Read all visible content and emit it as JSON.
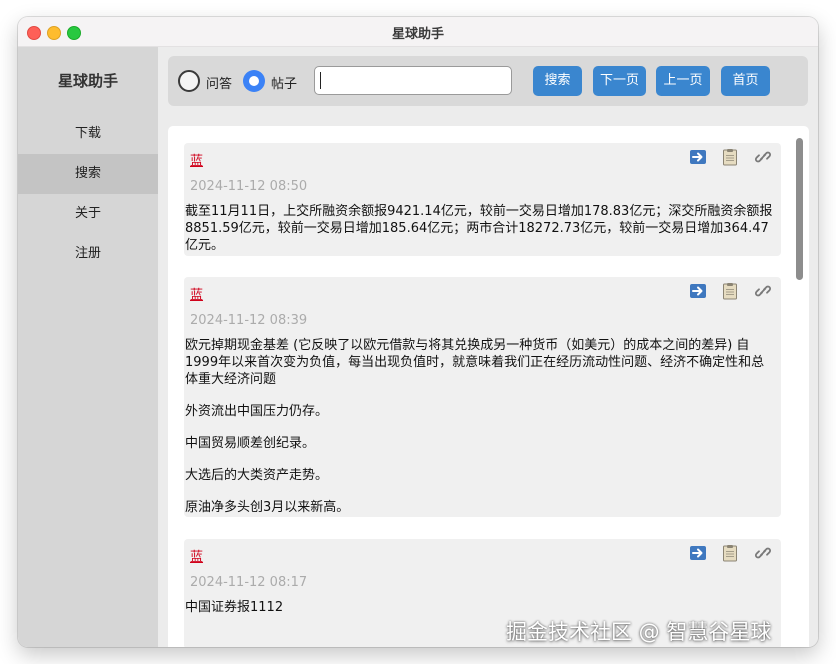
{
  "window": {
    "title": "星球助手"
  },
  "sidebar": {
    "title": "星球助手",
    "items": [
      {
        "label": "下载",
        "active": false
      },
      {
        "label": "搜索",
        "active": true
      },
      {
        "label": "关于",
        "active": false
      },
      {
        "label": "注册",
        "active": false
      }
    ]
  },
  "toolbar": {
    "radio_qa_label": "问答",
    "radio_post_label": "帖子",
    "selected": "帖子",
    "search_value": "",
    "search_label": "搜索",
    "next_label": "下一页",
    "prev_label": "上一页",
    "home_label": "首页"
  },
  "icons": {
    "forward": "arrow-right-square-icon",
    "copy": "clipboard-icon",
    "link": "chain-link-icon"
  },
  "colors": {
    "accent": "#3a86cf",
    "author": "#d0021b",
    "radio_selected": "#3b82f6"
  },
  "posts": [
    {
      "author": "蓝",
      "time": "2024-11-12 08:50",
      "paragraphs": [
        "截至11月11日，上交所融资余额报9421.14亿元，较前一交易日增加178.83亿元；深交所融资余额报8851.59亿元，较前一交易日增加185.64亿元；两市合计18272.73亿元，较前一交易日增加364.47亿元。"
      ]
    },
    {
      "author": "蓝",
      "time": "2024-11-12 08:39",
      "paragraphs": [
        "欧元掉期现金基差 (它反映了以欧元借款与将其兑换成另一种货币（如美元）的成本之间的差异) 自1999年以来首次变为负值，每当出现负值时，就意味着我们正在经历流动性问题、经济不确定性和总体重大经济问题",
        "外资流出中国压力仍存。",
        "中国贸易顺差创纪录。",
        "大选后的大类资产走势。",
        "原油净多头创3月以来新高。"
      ]
    },
    {
      "author": "蓝",
      "time": "2024-11-12 08:17",
      "paragraphs": [
        "中国证券报1112"
      ]
    }
  ],
  "watermark": "掘金技术社区 @ 智慧谷星球"
}
